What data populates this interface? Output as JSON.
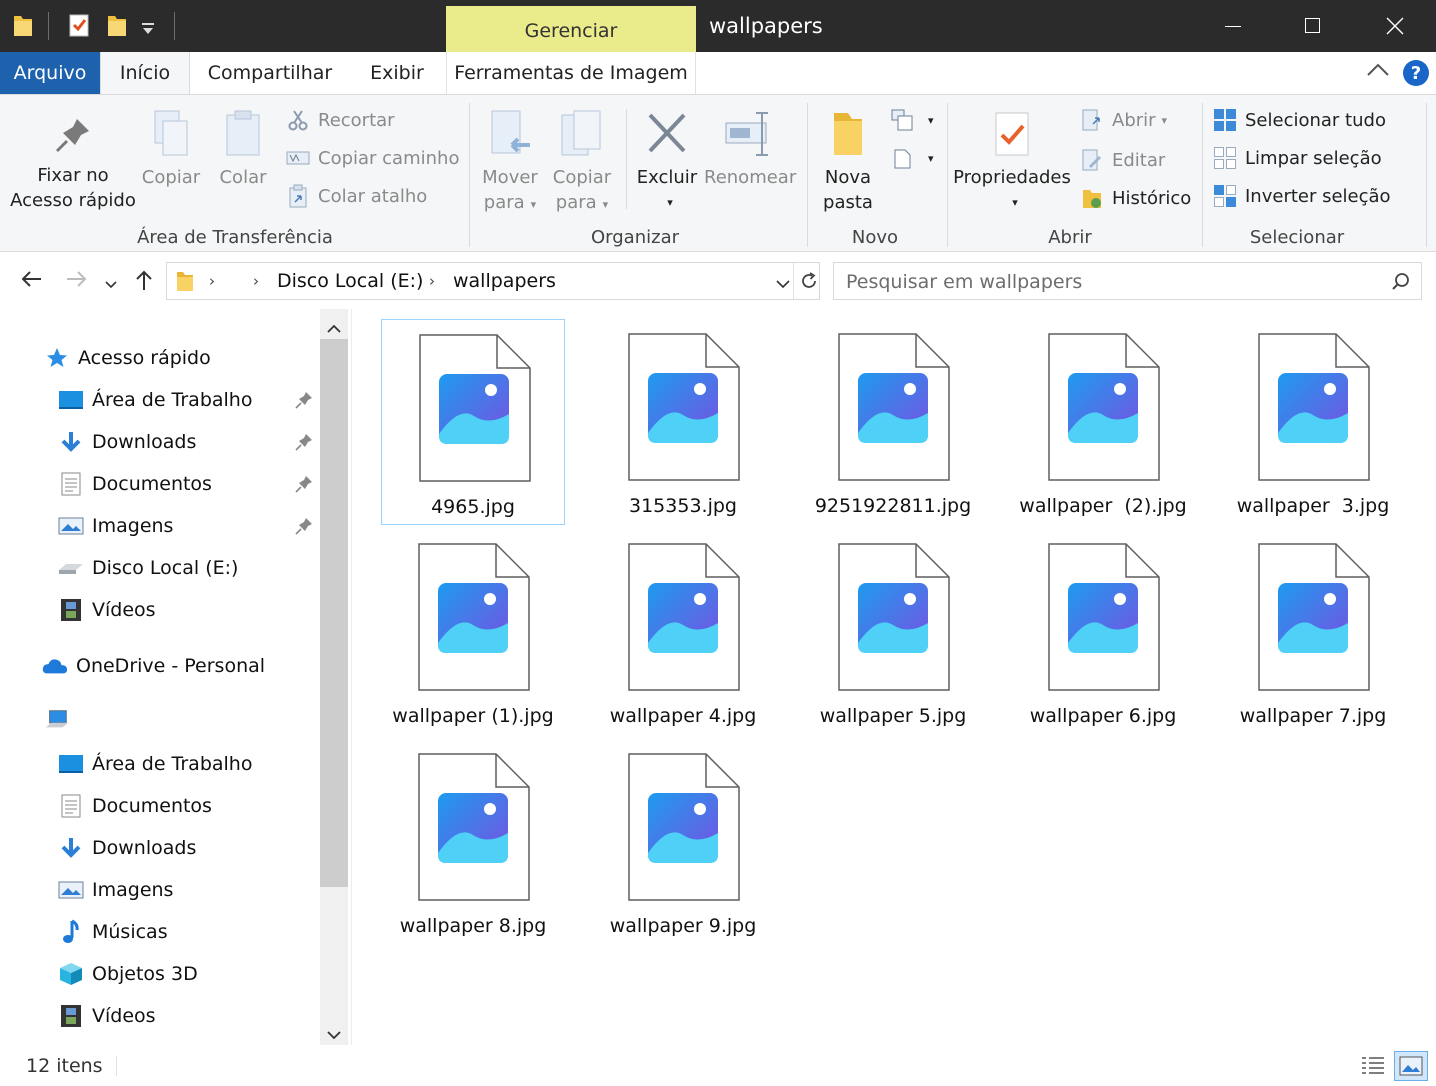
{
  "window": {
    "title": "wallpapers",
    "context_tab": "Gerenciar"
  },
  "ribbon_tabs": {
    "file": "Arquivo",
    "home": "Início",
    "share": "Compartilhar",
    "view": "Exibir",
    "image_tools": "Ferramentas de Imagem"
  },
  "ribbon": {
    "clipboard": {
      "group": "Área de Transferência",
      "pin_line1": "Fixar no",
      "pin_line2": "Acesso rápido",
      "copy": "Copiar",
      "paste": "Colar",
      "cut": "Recortar",
      "copy_path": "Copiar caminho",
      "paste_shortcut": "Colar atalho"
    },
    "organize": {
      "group": "Organizar",
      "move_line1": "Mover",
      "move_line2": "para",
      "copyto_line1": "Copiar",
      "copyto_line2": "para",
      "delete": "Excluir",
      "rename": "Renomear"
    },
    "new": {
      "group": "Novo",
      "folder_line1": "Nova",
      "folder_line2": "pasta"
    },
    "open": {
      "group": "Abrir",
      "properties": "Propriedades",
      "open": "Abrir",
      "edit": "Editar",
      "history": "Histórico"
    },
    "select": {
      "group": "Selecionar",
      "select_all": "Selecionar tudo",
      "select_none": "Limpar seleção",
      "invert": "Inverter seleção"
    }
  },
  "address": {
    "crumbs": [
      "Disco Local (E:)",
      "wallpapers"
    ],
    "search_placeholder": "Pesquisar em wallpapers"
  },
  "navpane": {
    "quick_access": "Acesso rápido",
    "quick_items": [
      {
        "label": "Área de Trabalho",
        "icon": "desktop-icon",
        "pinned": true
      },
      {
        "label": "Downloads",
        "icon": "downloads-icon",
        "pinned": true
      },
      {
        "label": "Documentos",
        "icon": "documents-icon",
        "pinned": true
      },
      {
        "label": "Imagens",
        "icon": "pictures-icon",
        "pinned": true
      },
      {
        "label": "Disco Local (E:)",
        "icon": "drive-icon",
        "pinned": false
      },
      {
        "label": "Vídeos",
        "icon": "videos-icon",
        "pinned": false
      }
    ],
    "onedrive": "OneDrive - Personal",
    "pc_items": [
      {
        "label": "Área de Trabalho",
        "icon": "desktop-icon"
      },
      {
        "label": "Documentos",
        "icon": "documents-icon"
      },
      {
        "label": "Downloads",
        "icon": "downloads-icon"
      },
      {
        "label": "Imagens",
        "icon": "pictures-icon"
      },
      {
        "label": "Músicas",
        "icon": "music-icon"
      },
      {
        "label": "Objetos 3D",
        "icon": "objects3d-icon"
      },
      {
        "label": "Vídeos",
        "icon": "videos-icon"
      }
    ]
  },
  "files": [
    {
      "name": "4965.jpg",
      "selected": true
    },
    {
      "name": "315353.jpg"
    },
    {
      "name": "9251922811.jpg"
    },
    {
      "name": "wallpaper  (2).jpg"
    },
    {
      "name": "wallpaper  3.jpg"
    },
    {
      "name": "wallpaper (1).jpg"
    },
    {
      "name": "wallpaper 4.jpg"
    },
    {
      "name": "wallpaper 5.jpg"
    },
    {
      "name": "wallpaper 6.jpg"
    },
    {
      "name": "wallpaper 7.jpg"
    },
    {
      "name": "wallpaper 8.jpg"
    },
    {
      "name": "wallpaper 9.jpg"
    }
  ],
  "status": {
    "count": "12 itens"
  },
  "colors": {
    "titlebar": "#2b2b2b",
    "context_tab": "#eaeb8b",
    "file_tab": "#1e62ae",
    "ribbon_bg": "#f5f6f7",
    "selection_border": "#99d1ff"
  }
}
